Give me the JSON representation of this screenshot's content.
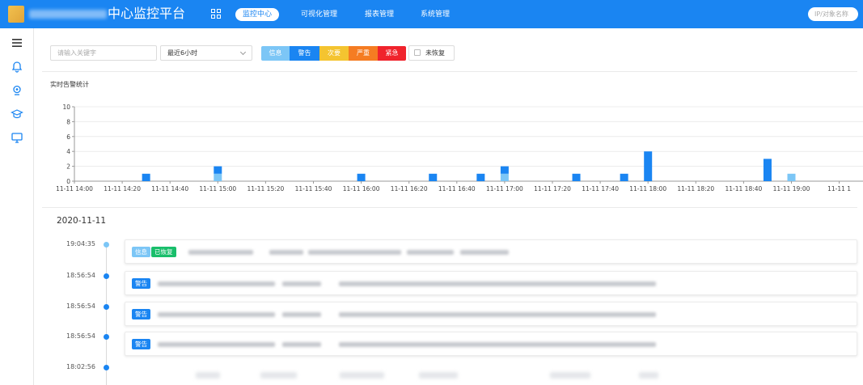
{
  "app": {
    "title_suffix": "中心监控平台"
  },
  "nav": [
    {
      "label": "监控中心",
      "active": true
    },
    {
      "label": "可视化管理",
      "active": false
    },
    {
      "label": "报表管理",
      "active": false
    },
    {
      "label": "系统管理",
      "active": false
    }
  ],
  "top_search": {
    "placeholder": "IP/对象名称"
  },
  "sidebar": {
    "icons": [
      "menu-icon",
      "bell-icon",
      "location-pin-icon",
      "graduation-cap-icon",
      "monitor-icon"
    ]
  },
  "filters": {
    "keyword_placeholder": "请输入关键字",
    "time_range": "最近6小时",
    "levels": [
      {
        "label": "信息",
        "color": "#7cc6f6"
      },
      {
        "label": "警告",
        "color": "#1a85f2"
      },
      {
        "label": "次要",
        "color": "#f4c430"
      },
      {
        "label": "严重",
        "color": "#f57c22"
      },
      {
        "label": "紧急",
        "color": "#f0232c"
      }
    ],
    "unrecovered_label": "未恢复"
  },
  "chart_title": "实时告警统计",
  "chart_data": {
    "type": "bar",
    "title": "",
    "xlabel": "",
    "ylabel": "",
    "ylim": [
      0,
      10
    ],
    "yticks": [
      0,
      2,
      4,
      6,
      8,
      10
    ],
    "x_tick_labels": [
      "11-11 14:00",
      "11-11 14:20",
      "11-11 14:40",
      "11-11 15:00",
      "11-11 15:20",
      "11-11 15:40",
      "11-11 16:00",
      "11-11 16:20",
      "11-11 16:40",
      "11-11 17:00",
      "11-11 17:20",
      "11-11 17:40",
      "11-11 18:00",
      "11-11 18:20",
      "11-11 18:40",
      "11-11 19:00",
      "11-11 1"
    ],
    "stacked": true,
    "grid": true,
    "legend": "none",
    "series": [
      {
        "color": "#7cc6f6",
        "points": [
          {
            "x": "11-11 15:00",
            "y": 1
          },
          {
            "x": "11-11 17:00",
            "y": 1
          },
          {
            "x": "11-11 19:00",
            "y": 1
          }
        ]
      },
      {
        "color": "#1a85f2",
        "points": [
          {
            "x": "11-11 14:30",
            "y": 1
          },
          {
            "x": "11-11 15:00",
            "y": 1
          },
          {
            "x": "11-11 16:00",
            "y": 1
          },
          {
            "x": "11-11 16:30",
            "y": 1
          },
          {
            "x": "11-11 16:50",
            "y": 1
          },
          {
            "x": "11-11 17:00",
            "y": 1
          },
          {
            "x": "11-11 17:30",
            "y": 1
          },
          {
            "x": "11-11 17:50",
            "y": 1
          },
          {
            "x": "11-11 18:00",
            "y": 4
          },
          {
            "x": "11-11 18:50",
            "y": 3
          }
        ]
      }
    ]
  },
  "timeline": {
    "date": "2020-11-11",
    "events": [
      {
        "time": "19:04:35",
        "tags": [
          {
            "label": "信息",
            "color": "#7cc6f6"
          },
          {
            "label": "已恢复",
            "color": "#19be6b"
          }
        ],
        "dot_color": "#7cc6f6"
      },
      {
        "time": "18:56:54",
        "tags": [
          {
            "label": "警告",
            "color": "#1a85f2"
          }
        ],
        "dot_color": "#1a85f2"
      },
      {
        "time": "18:56:54",
        "tags": [
          {
            "label": "警告",
            "color": "#1a85f2"
          }
        ],
        "dot_color": "#1a85f2"
      },
      {
        "time": "18:56:54",
        "tags": [
          {
            "label": "警告",
            "color": "#1a85f2"
          }
        ],
        "dot_color": "#1a85f2"
      },
      {
        "time": "18:02:56",
        "tags": [],
        "dot_color": "#1a85f2"
      }
    ]
  }
}
